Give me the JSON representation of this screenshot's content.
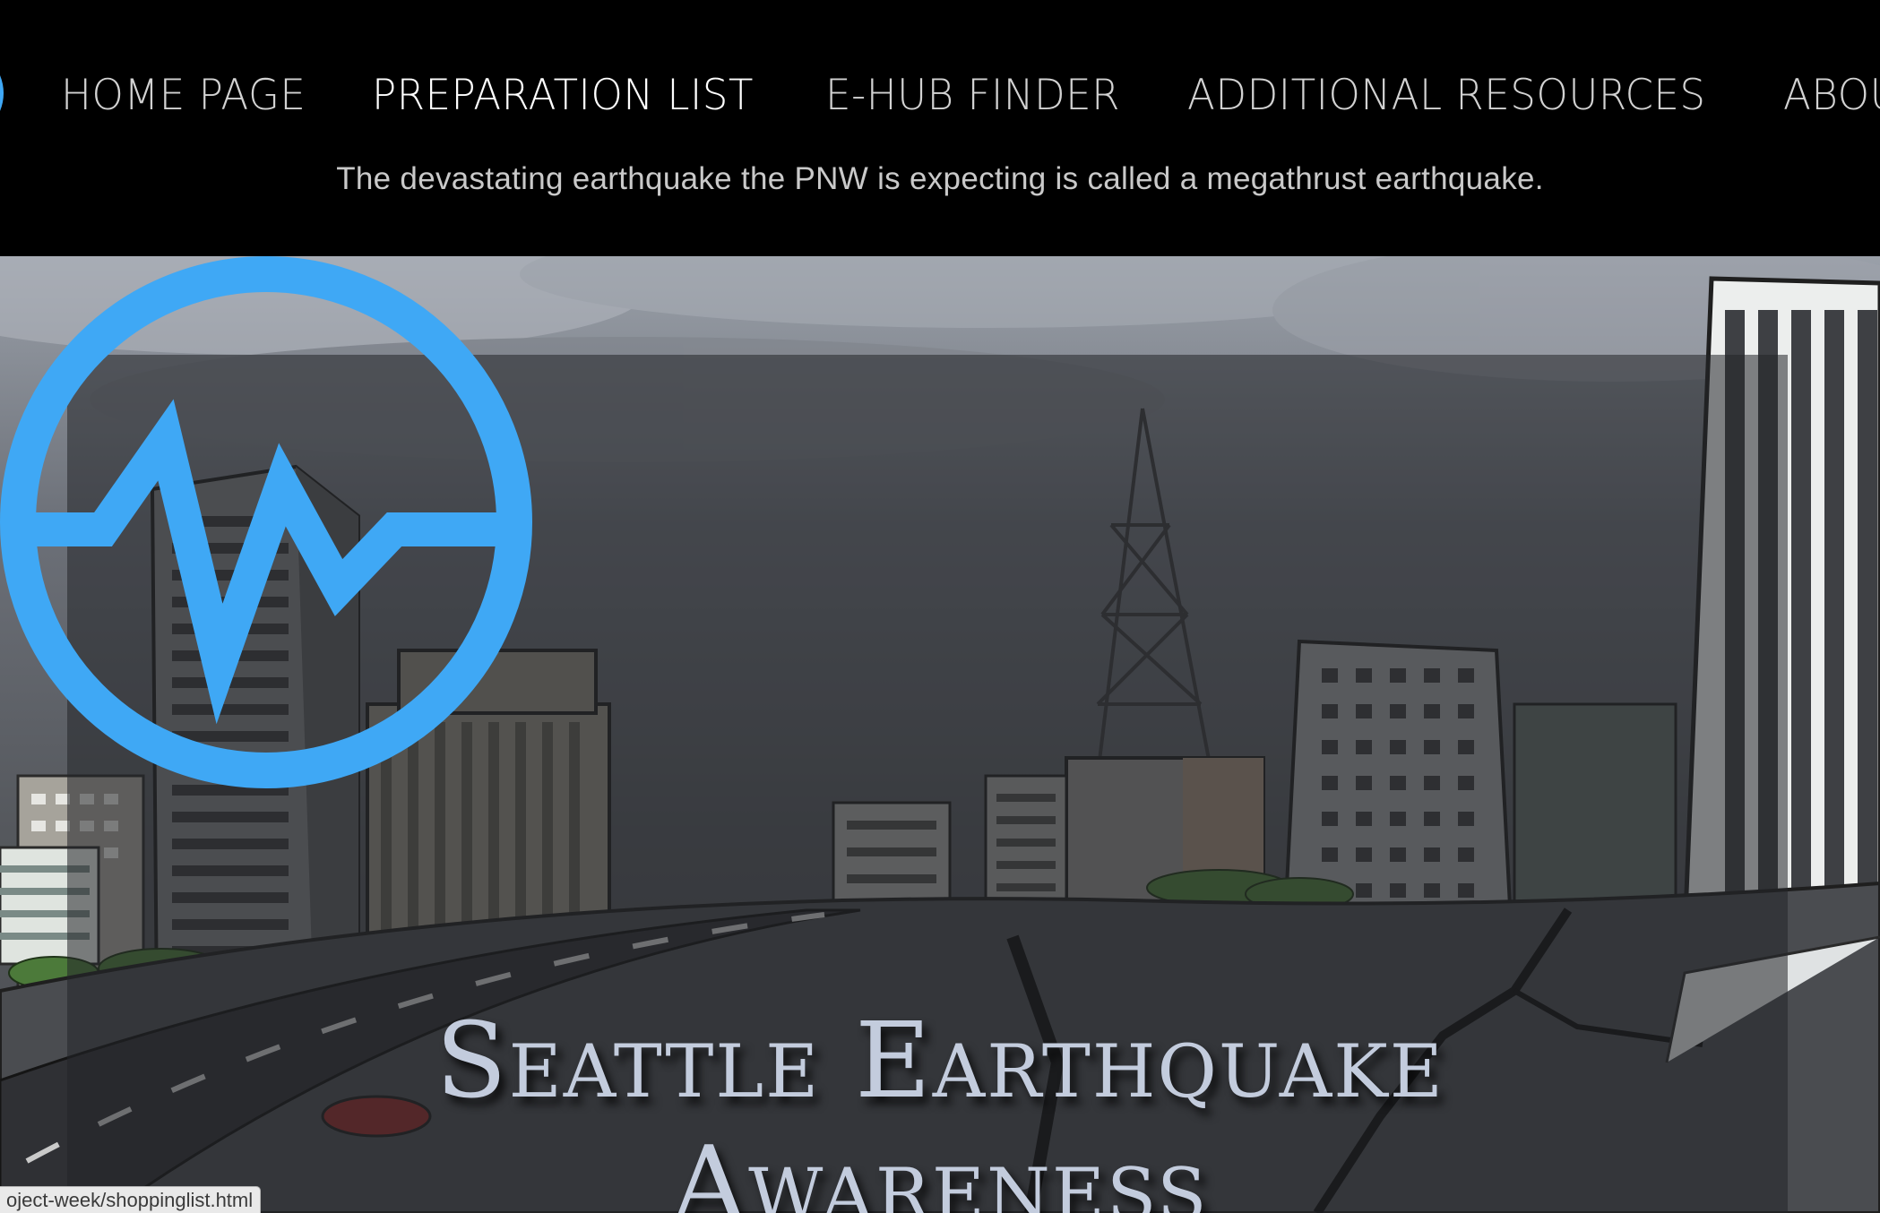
{
  "nav": {
    "items": [
      {
        "label": "HOME PAGE",
        "active": false
      },
      {
        "label": "PREPARATION LIST",
        "active": true
      },
      {
        "label": "E-HUB FINDER",
        "active": false
      },
      {
        "label": "ADDITIONAL RESOURCES",
        "active": false
      },
      {
        "label": "ABOUT US",
        "active": false
      }
    ],
    "logo_icon": "seismograph-logo-icon"
  },
  "header": {
    "fact_text": "The devastating earthquake the PNW is expecting is called a megathrust earthquake."
  },
  "hero": {
    "title_line1": "Seattle Earthquake",
    "title_line2": "Awareness",
    "emblem_icon": "seismograph-emblem-icon"
  },
  "status_bar": {
    "url": "oject-week/shoppinglist.html"
  },
  "colors": {
    "accent": "#3fa8f5",
    "title": "#c3ccdd",
    "header_bg": "#000000"
  }
}
